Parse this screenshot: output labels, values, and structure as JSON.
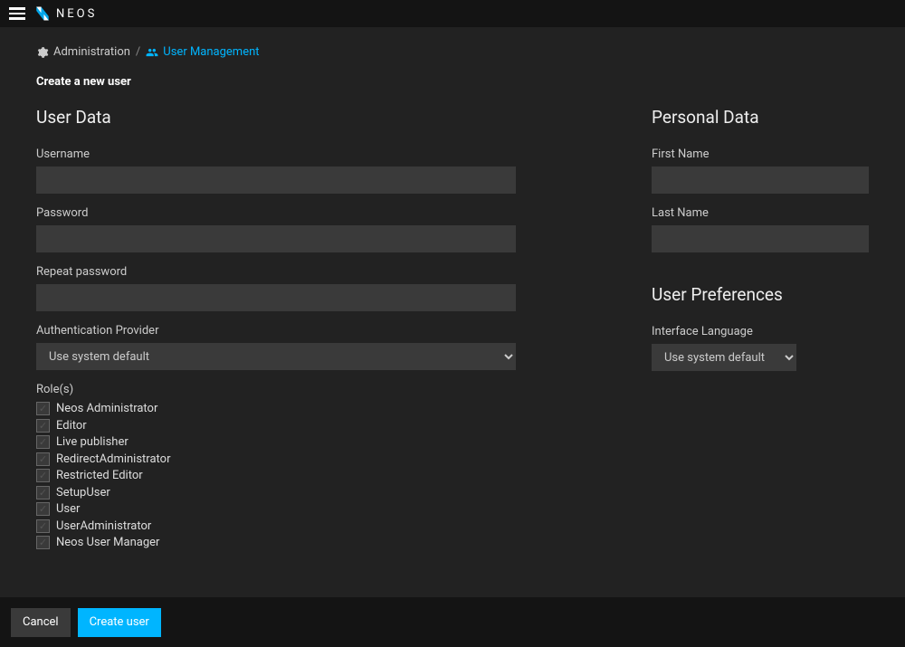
{
  "brand": {
    "text": "NEOS"
  },
  "breadcrumb": {
    "administration": "Administration",
    "usermanagement": "User Management"
  },
  "page": {
    "subtitle": "Create a new user"
  },
  "userdata": {
    "title": "User Data",
    "username_label": "Username",
    "password_label": "Password",
    "repeat_password_label": "Repeat password",
    "auth_provider_label": "Authentication Provider",
    "auth_provider_value": "Use system default",
    "roles_label": "Role(s)",
    "roles": [
      "Neos Administrator",
      "Editor",
      "Live publisher",
      "RedirectAdministrator",
      "Restricted Editor",
      "SetupUser",
      "User",
      "UserAdministrator",
      "Neos User Manager"
    ]
  },
  "personal": {
    "title": "Personal Data",
    "firstname_label": "First Name",
    "lastname_label": "Last Name"
  },
  "prefs": {
    "title": "User Preferences",
    "language_label": "Interface Language",
    "language_value": "Use system default"
  },
  "footer": {
    "cancel": "Cancel",
    "create": "Create user"
  }
}
